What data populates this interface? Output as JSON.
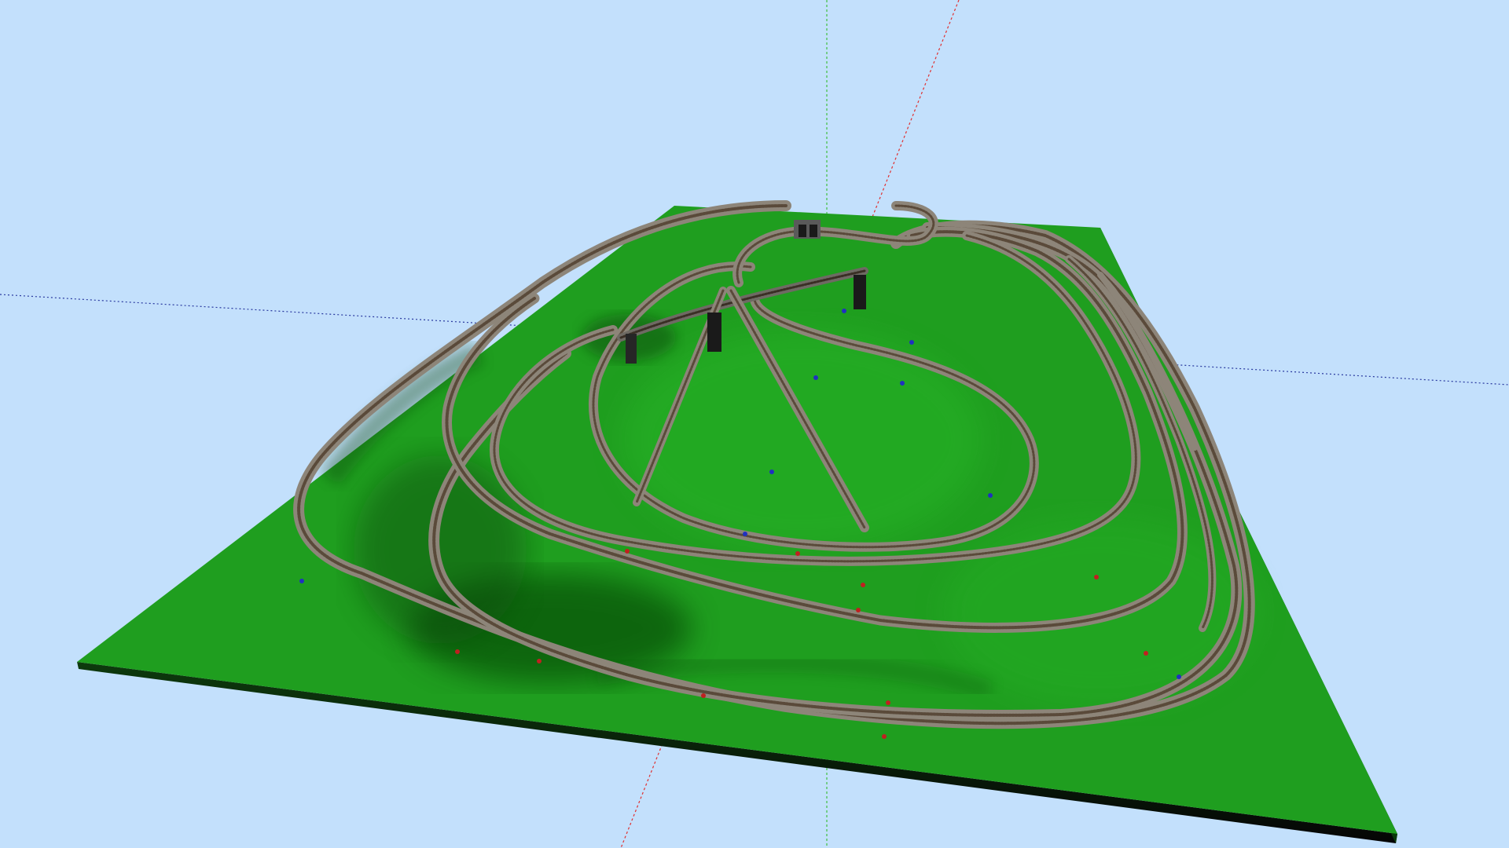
{
  "viewport": {
    "background_color": "#c3e0fc",
    "axis_colors": {
      "red_axis": "#e03030",
      "green_axis": "#3fbf3f",
      "blue_axis": "#2a3aa0"
    }
  },
  "scene": {
    "terrain_color": "#1f9e1f",
    "terrain_shadow_color": "#0d5c0d",
    "terrain_edge_color": "#0a0a0a",
    "track_ballast_color": "#8d8579",
    "track_rail_color": "#5a4a3a",
    "pillar_color": "#1a1a1a",
    "marker_colors": [
      "#c02020",
      "#2030c0"
    ]
  }
}
